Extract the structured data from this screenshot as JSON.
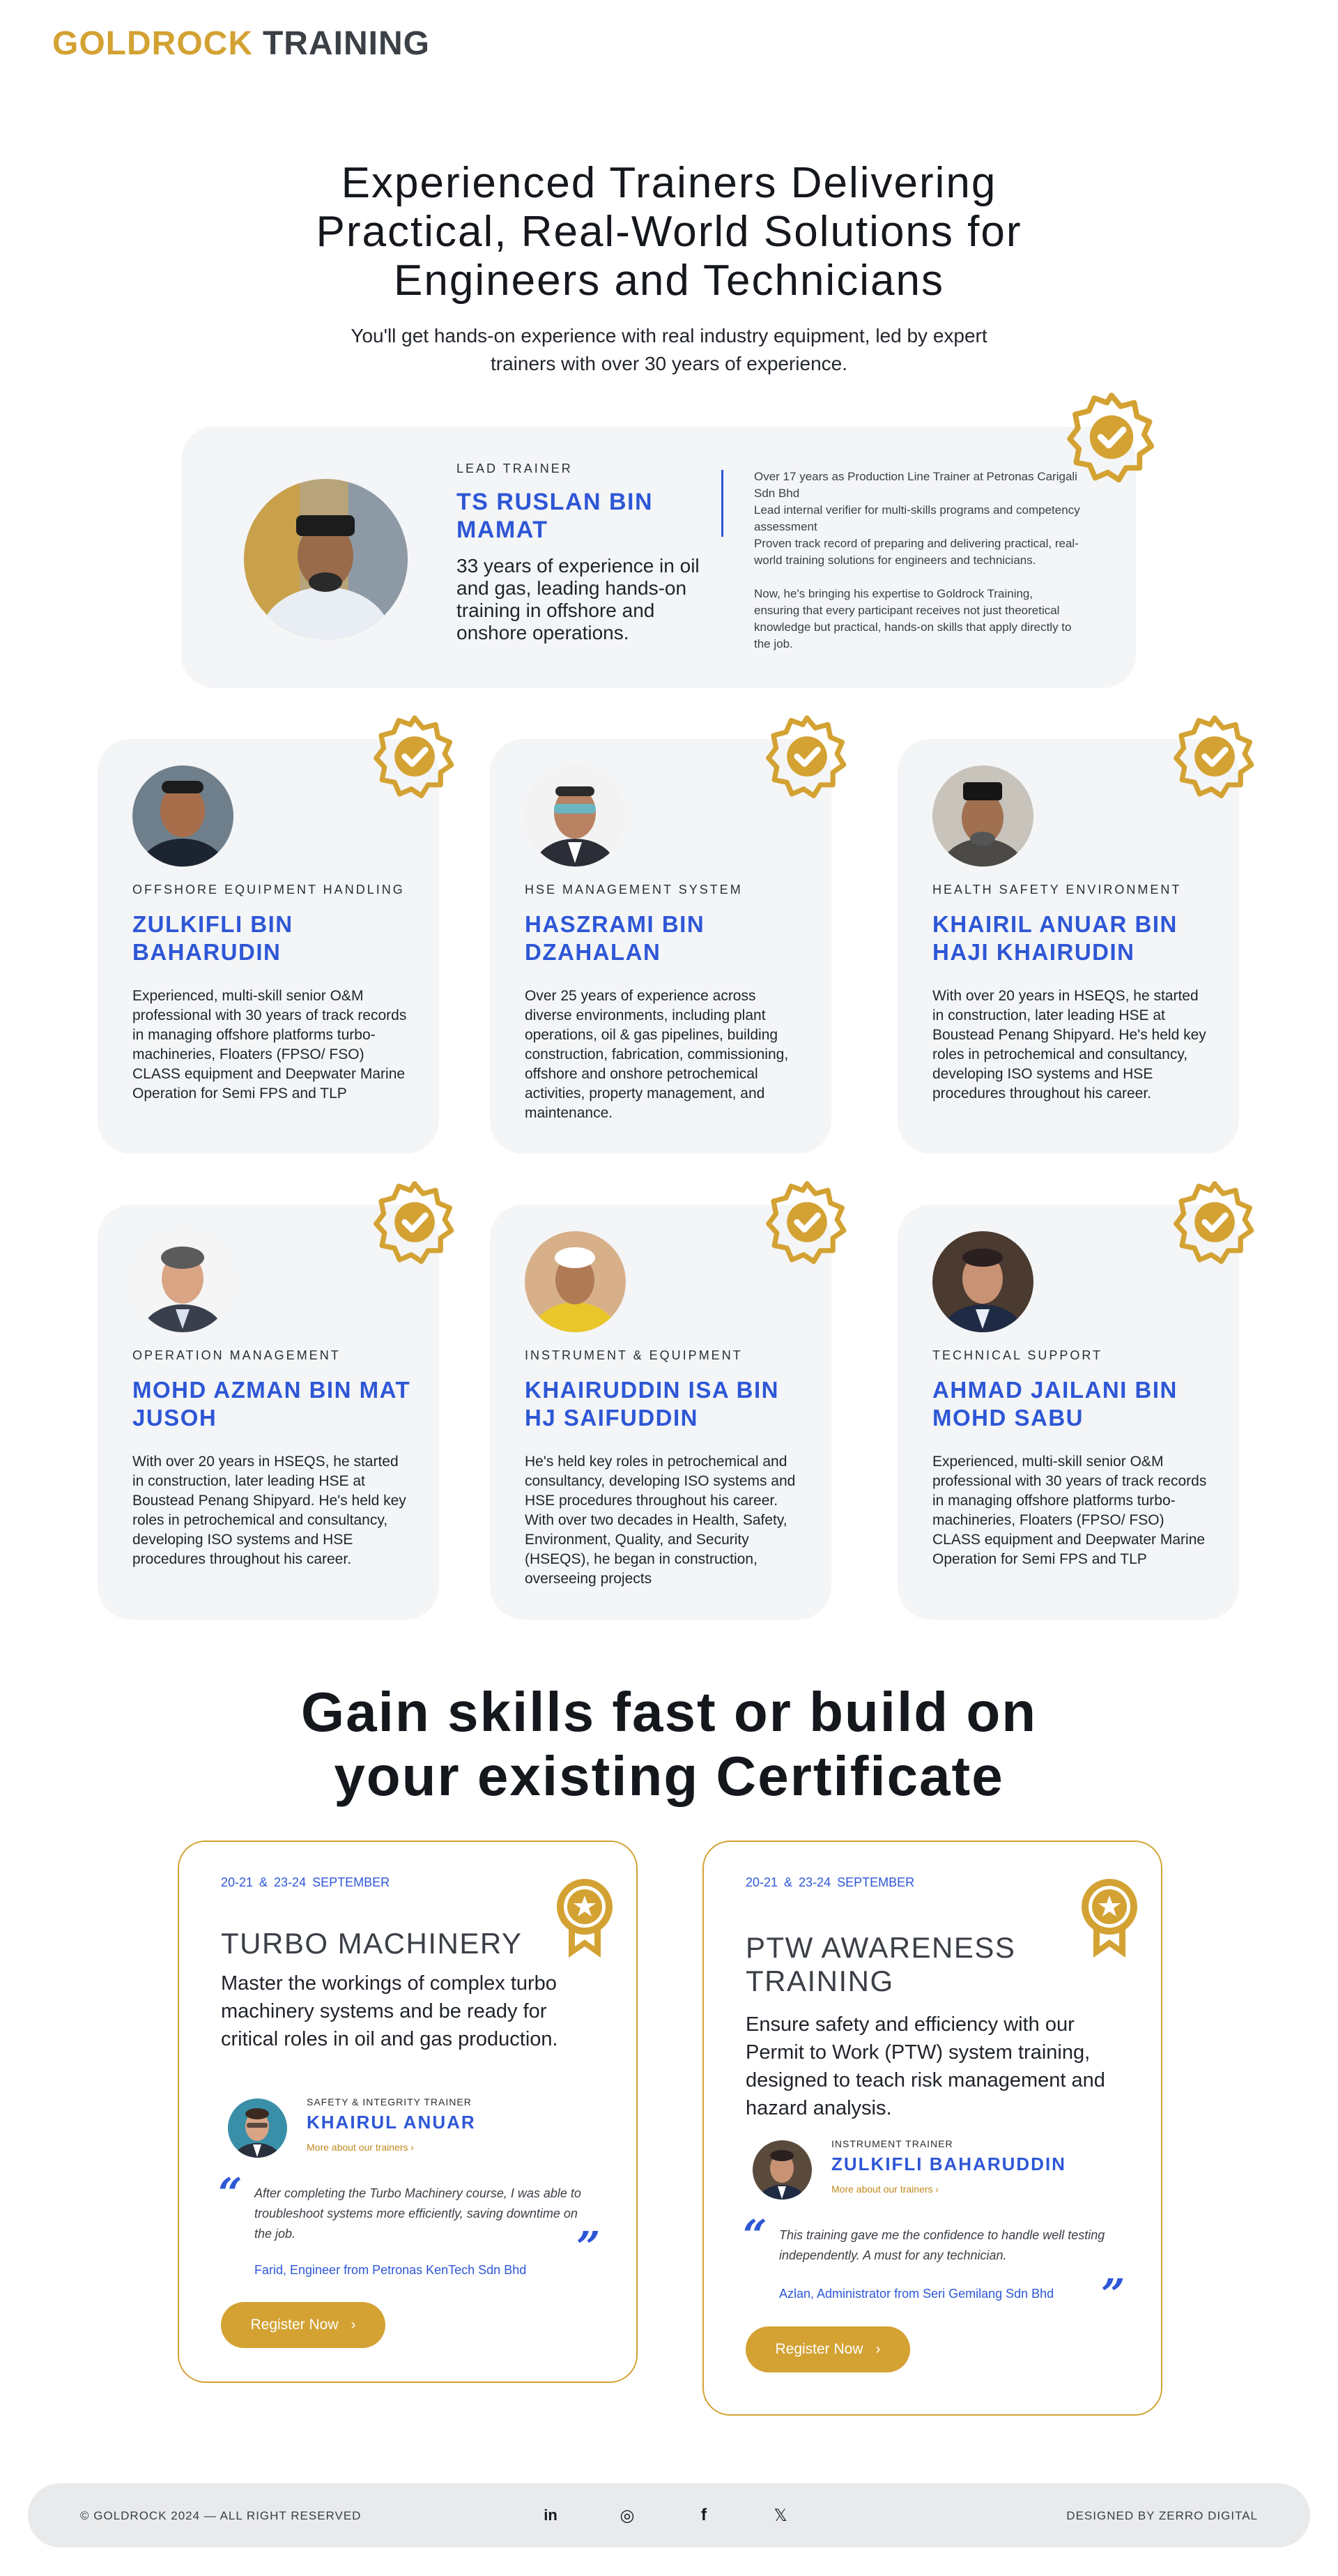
{
  "brand": {
    "part1": "GOLDROCK",
    "part2": "TRAINING"
  },
  "hero": {
    "title": "Experienced Trainers Delivering Practical, Real-World Solutions for Engineers and Technicians",
    "subtitle": "You'll get hands-on experience with real industry equipment, led by expert trainers with over 30 years of experience."
  },
  "lead_trainer": {
    "role": "LEAD TRAINER",
    "name": "TS RUSLAN BIN MAMAT",
    "summary": "33 years of experience in oil and gas, leading hands-on training in offshore and onshore operations.",
    "details": [
      "Over 17 years as Production Line Trainer at Petronas Carigali Sdn Bhd",
      "Lead internal verifier for multi-skills programs and competency assessment",
      "Proven track record of preparing and delivering practical, real-world training solutions for engineers and technicians."
    ],
    "closing": "Now, he's bringing his expertise to Goldrock Training, ensuring that every participant receives not just theoretical knowledge but practical, hands-on skills that apply directly to the job."
  },
  "trainers": [
    {
      "role": "OFFSHORE EQUIPMENT HANDLING",
      "name": "ZULKIFLI BIN BAHARUDIN",
      "description": "Experienced, multi-skill senior O&M professional with 30 years of track records in managing offshore platforms turbo-machineries, Floaters (FPSO/ FSO) CLASS equipment and Deepwater Marine Operation for Semi FPS and TLP"
    },
    {
      "role": "HSE MANAGEMENT SYSTEM",
      "name": "HASZRAMI BIN DZAHALAN",
      "description": "Over 25 years of experience across diverse environments, including plant operations, oil & gas pipelines, building construction, fabrication, commissioning, offshore and onshore petrochemical activities, property management, and maintenance."
    },
    {
      "role": "HEALTH SAFETY ENVIRONMENT",
      "name": "KHAIRIL ANUAR BIN HAJI KHAIRUDIN",
      "description": "With over 20 years in HSEQS, he started in construction, later leading HSE at Boustead Penang Shipyard. He's held key roles in petrochemical and consultancy, developing ISO systems and HSE procedures throughout his career."
    },
    {
      "role": "OPERATION MANAGEMENT",
      "name": "MOHD AZMAN BIN MAT JUSOH",
      "description": "With over 20 years in HSEQS, he started in construction, later leading HSE at Boustead Penang Shipyard. He's held key roles in petrochemical and consultancy, developing ISO systems and HSE procedures throughout his career."
    },
    {
      "role": "INSTRUMENT & EQUIPMENT",
      "name": "KHAIRUDDIN ISA BIN HJ SAIFUDDIN",
      "description": "He's held key roles in petrochemical and consultancy, developing ISO systems and HSE procedures throughout his career. With over two decades in Health, Safety, Environment, Quality, and Security (HSEQS), he began in construction, overseeing projects"
    },
    {
      "role": "TECHNICAL SUPPORT",
      "name": "AHMAD JAILANI BIN MOHD SABU",
      "description": "Experienced, multi-skill senior O&M professional with 30 years of track records in managing offshore platforms turbo-machineries, Floaters (FPSO/ FSO) CLASS equipment and Deepwater Marine Operation for Semi FPS and TLP"
    }
  ],
  "courses_section": {
    "title": "Gain skills fast or build on your existing Certificate"
  },
  "courses": [
    {
      "date": "20-21  &  23-24 SEPTEMBER",
      "title": "TURBO MACHINERY",
      "description": "Master the workings of complex turbo machinery systems and be ready for critical roles in oil and gas production.",
      "trainer_role": "SAFETY & INTEGRITY TRAINER",
      "trainer_name": "KHAIRUL ANUAR",
      "more_label": "More about our trainers",
      "testimonial": "After completing the Turbo Machinery course, I was able to troubleshoot systems more efficiently, saving downtime on the job.",
      "author": "Farid, Engineer from Petronas KenTech Sdn Bhd",
      "button": "Register Now"
    },
    {
      "date": "20-21  &  23-24 SEPTEMBER",
      "title": "PTW AWARENESS TRAINING",
      "description": "Ensure safety and efficiency with our Permit to Work (PTW) system training, designed to teach risk management and hazard analysis.",
      "trainer_role": "INSTRUMENT TRAINER",
      "trainer_name": "ZULKIFLI BAHARUDDIN",
      "more_label": "More about our trainers",
      "testimonial": "This training gave me the confidence to handle well testing independently. A must for any technician.",
      "author": "Azlan, Administrator from Seri Gemilang Sdn Bhd",
      "button": "Register Now"
    }
  ],
  "footer": {
    "copyright": "© GOLDROCK  2024 — ALL RIGHT RESERVED",
    "credit": "DESIGNED BY ZERRO DIGITAL",
    "social": [
      {
        "icon": "linkedin-icon",
        "glyph": "in"
      },
      {
        "icon": "instagram-icon",
        "glyph": "◎"
      },
      {
        "icon": "facebook-icon",
        "glyph": "f"
      },
      {
        "icon": "x-icon",
        "glyph": "𝕏"
      }
    ]
  },
  "colors": {
    "gold": "#d3a233",
    "blue": "#2e57d6",
    "card_bg": "#f4f5f7",
    "dark": "#3b3f46"
  },
  "icons": {
    "badge": "verified-badge-icon",
    "ribbon": "award-ribbon-icon",
    "arrow": "chevron-right-icon"
  }
}
